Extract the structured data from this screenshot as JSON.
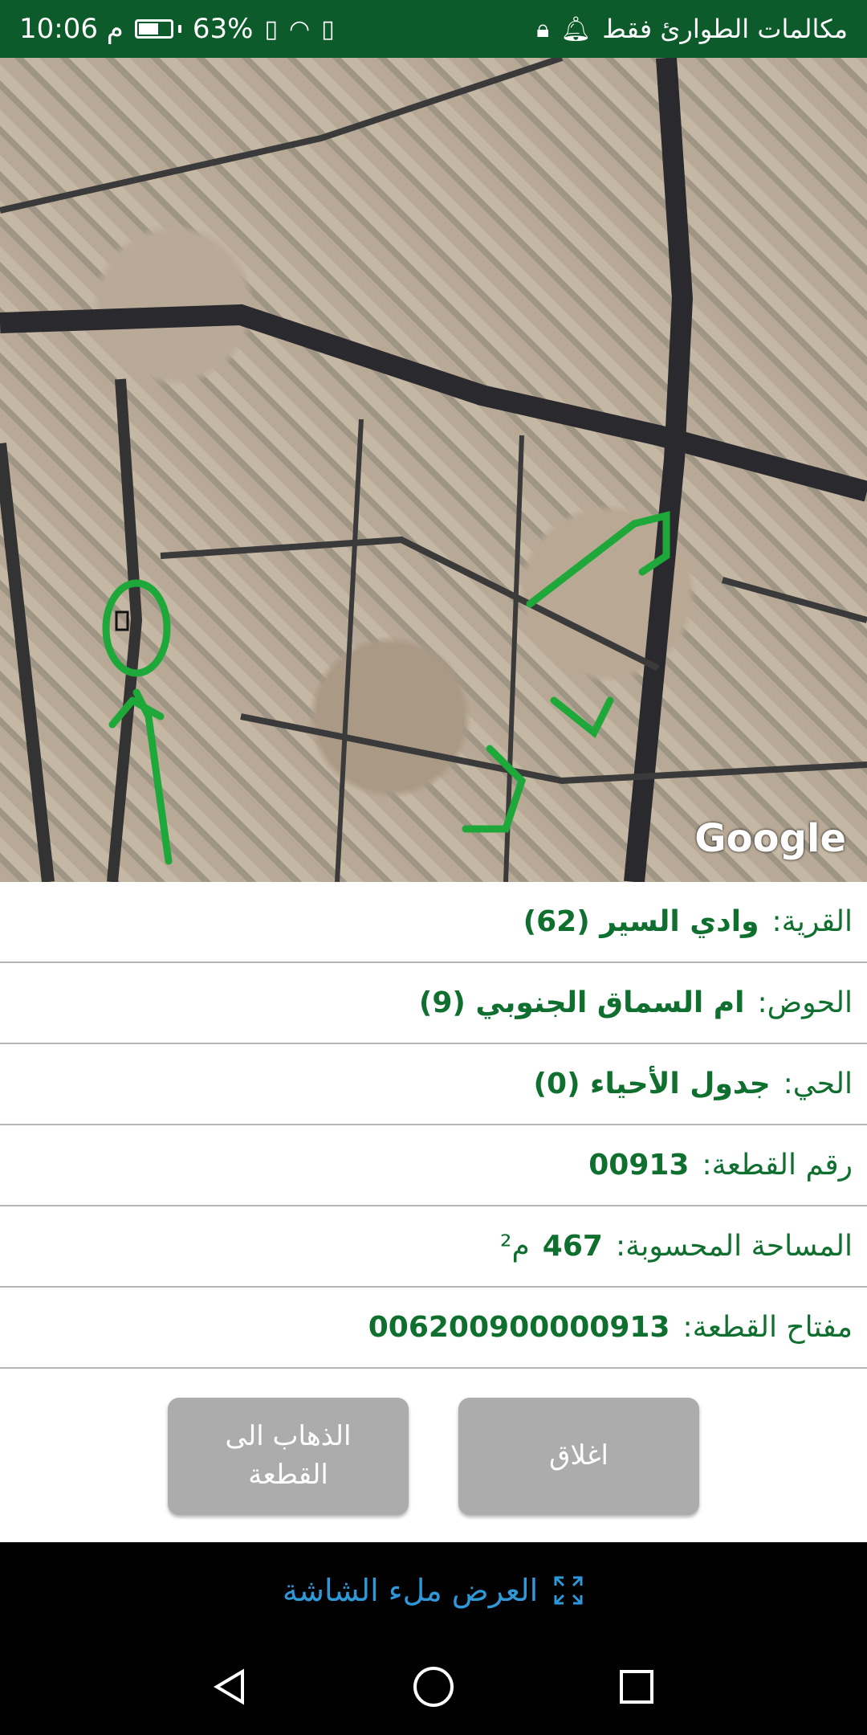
{
  "status_bar": {
    "time": "10:06 م",
    "battery_percent": "63%",
    "battery_level": 0.63,
    "carrier_text": "مكالمات الطوارئ فقط"
  },
  "map": {
    "provider": "Google",
    "annotation_text": "العمارة"
  },
  "parcel": {
    "village_label": "القرية:",
    "village_value": "وادي السير (62)",
    "basin_label": "الحوض:",
    "basin_value": "ام السماق الجنوبي (9)",
    "district_label": "الحي:",
    "district_value": "جدول الأحياء (0)",
    "parcel_no_label": "رقم القطعة:",
    "parcel_no_value": "00913",
    "area_label": "المساحة المحسوبة:",
    "area_value": "467",
    "area_unit": "م²",
    "key_label": "مفتاح القطعة:",
    "key_value": "006200900000913"
  },
  "buttons": {
    "go_to_parcel": "الذهاب الى\nالقطعة",
    "close": "اغلاق"
  },
  "fullscreen": {
    "label": "العرض ملء الشاشة"
  },
  "colors": {
    "status_bar": "#0d5a2a",
    "label_green": "#0f6f2e",
    "button_gray": "#acacac",
    "link_blue": "#2f98d8",
    "annotation_green": "#1fa83a"
  }
}
